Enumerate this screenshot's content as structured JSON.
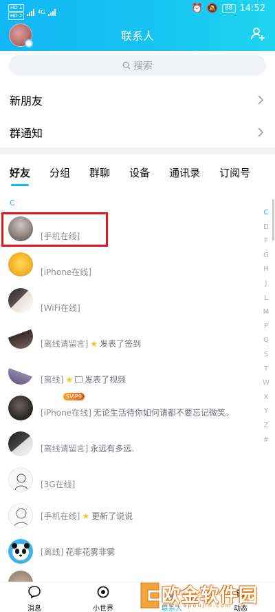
{
  "status_bar": {
    "sim_labels": [
      "HD 1",
      "HD 2"
    ],
    "network": "4G",
    "battery": "88",
    "time": "14:52"
  },
  "header": {
    "title": "联系人",
    "add_icon": "add-friend-icon"
  },
  "search": {
    "placeholder": "搜索"
  },
  "entries": [
    {
      "label": "新朋友"
    },
    {
      "label": "群通知"
    }
  ],
  "tabs": [
    {
      "label": "好友",
      "active": true
    },
    {
      "label": "分组"
    },
    {
      "label": "群聊"
    },
    {
      "label": "设备"
    },
    {
      "label": "通讯录"
    },
    {
      "label": "订阅号"
    }
  ],
  "section_letter": "C",
  "index_letters": [
    "C",
    "D",
    "F",
    "G",
    "H",
    "J",
    "L",
    "M",
    "P",
    "Q",
    "S",
    "T",
    "W",
    "X",
    "Y",
    "Z",
    "#"
  ],
  "contacts": [
    {
      "presence": "[手机在线]",
      "text": ""
    },
    {
      "presence": "[iPhone在线]",
      "text": ""
    },
    {
      "presence": "[WiFi在线]",
      "text": ""
    },
    {
      "presence": "[离线请留言]",
      "text": "发表了签到",
      "star": true
    },
    {
      "presence": "[离线]",
      "text": "发表了视频",
      "star": true,
      "media": true
    },
    {
      "presence": "[iPhone在线]",
      "text": "无论生活待你如何请都不要忘记微笑。",
      "vip": "SVIP9"
    },
    {
      "presence": "[离线请留言]",
      "text": "永远有多远."
    },
    {
      "presence": "[3G在线]",
      "text": ""
    },
    {
      "presence": "[手机在线]",
      "text": "更新了说说",
      "star": true
    },
    {
      "presence": "[离线]",
      "text": "花非花雾非雾"
    }
  ],
  "bottom_nav": [
    {
      "label": "消息"
    },
    {
      "label": "小世界"
    },
    {
      "label": "联系人"
    },
    {
      "label": "动态"
    }
  ],
  "watermark": {
    "text": "欧金软件园",
    "url": "www.apoujin.com"
  },
  "colors": {
    "accent": "#12b7f5",
    "highlight": "#e0161a"
  }
}
